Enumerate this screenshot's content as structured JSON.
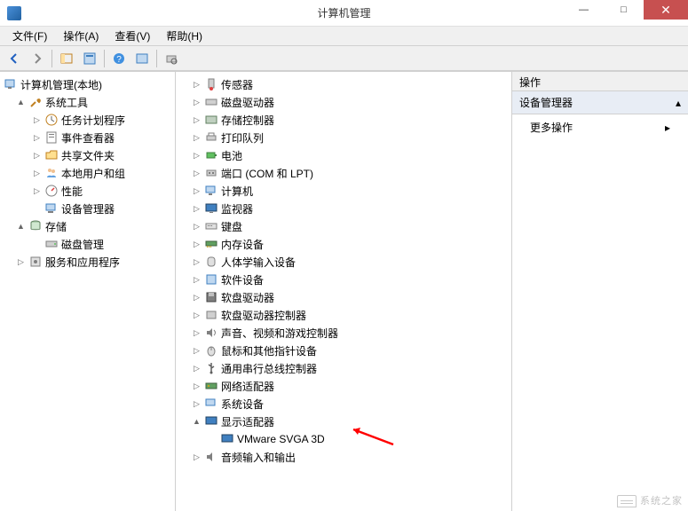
{
  "window": {
    "title": "计算机管理",
    "controls": {
      "minimize": "—",
      "maximize": "□",
      "close": "✕"
    }
  },
  "menu": {
    "file": "文件(F)",
    "action": "操作(A)",
    "view": "查看(V)",
    "help": "帮助(H)"
  },
  "toolbar": {
    "back": "◄",
    "forward": "►"
  },
  "leftTree": {
    "root": "计算机管理(本地)",
    "systemTools": "系统工具",
    "taskScheduler": "任务计划程序",
    "eventViewer": "事件查看器",
    "sharedFolders": "共享文件夹",
    "localUsers": "本地用户和组",
    "performance": "性能",
    "deviceManager": "设备管理器",
    "storage": "存储",
    "diskMgmt": "磁盘管理",
    "servicesApps": "服务和应用程序"
  },
  "midTree": {
    "sensors": "传感器",
    "diskDrives": "磁盘驱动器",
    "storageCtrl": "存储控制器",
    "printQueues": "打印队列",
    "batteries": "电池",
    "ports": "端口 (COM 和 LPT)",
    "computer": "计算机",
    "monitors": "监视器",
    "keyboards": "键盘",
    "memory": "内存设备",
    "hid": "人体学输入设备",
    "software": "软件设备",
    "floppyDrives": "软盘驱动器",
    "floppyCtrl": "软盘驱动器控制器",
    "sound": "声音、视频和游戏控制器",
    "mice": "鼠标和其他指针设备",
    "usb": "通用串行总线控制器",
    "network": "网络适配器",
    "system": "系统设备",
    "display": "显示适配器",
    "displayChild": "VMware SVGA 3D",
    "audio": "音频输入和输出"
  },
  "rightPane": {
    "header": "操作",
    "section": "设备管理器",
    "moreActions": "更多操作"
  },
  "watermark": "系统之家"
}
